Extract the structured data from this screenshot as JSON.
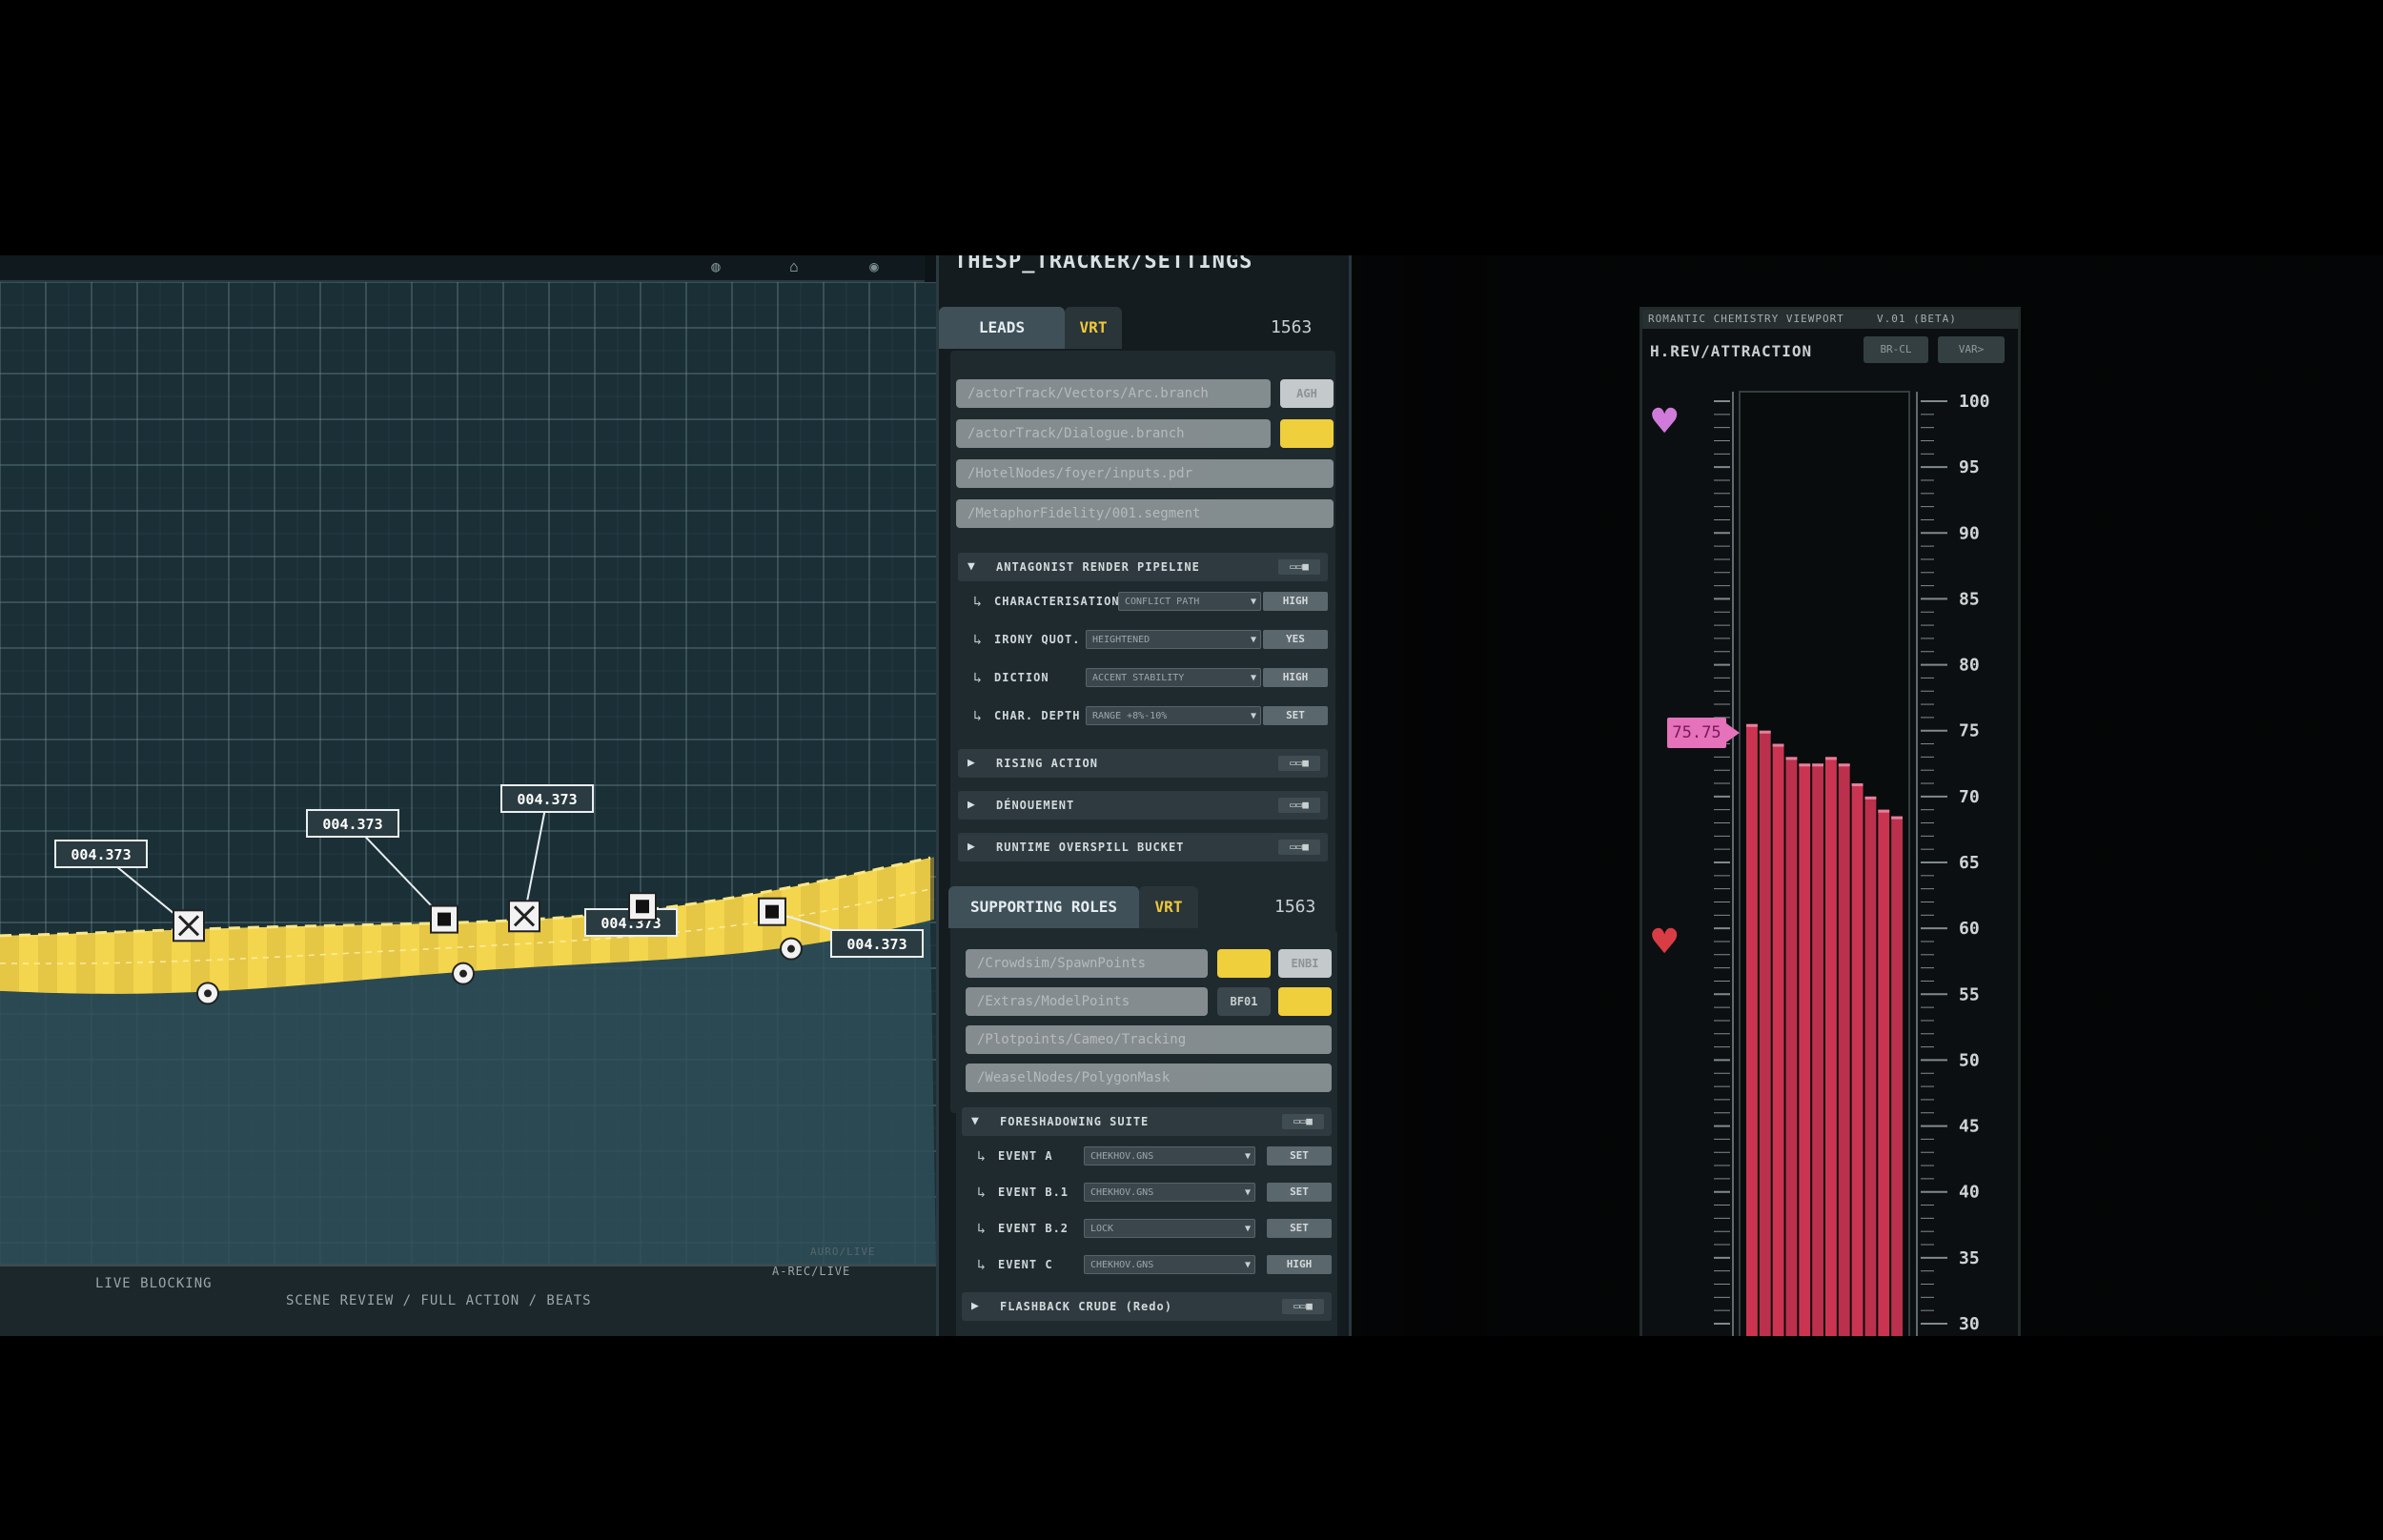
{
  "graph": {
    "top_icons": [
      "globe-icon",
      "person-icon",
      "camera-icon"
    ],
    "point_labels": [
      "004.373",
      "004.373",
      "004.373",
      "004.373",
      "004.373"
    ],
    "bottom_bar": {
      "left_text": "LIVE BLOCKING",
      "mid_text": "SCENE REVIEW / FULL ACTION / BEATS",
      "corner_text": "A-REC/LIVE",
      "graph_caption": "AURO/LIVE"
    },
    "colors": {
      "band": "#f4d64e",
      "band_dark": "#d8b63b",
      "grid": "#6f8a92",
      "fill": "#2f4e58"
    }
  },
  "settings": {
    "title": "THESP_TRACKER/SETTINGS",
    "leads_section": {
      "tab_label": "LEADS",
      "vrt_label": "VRT",
      "count": "1563",
      "paths": [
        {
          "value": "/actorTrack/Vectors/Arc.branch",
          "button": "AGH",
          "button_color": "grey"
        },
        {
          "value": "/actorTrack/Dialogue.branch",
          "button": "",
          "button_color": "yellow"
        },
        {
          "value": "/HotelNodes/foyer/inputs.pdr",
          "button": null
        },
        {
          "value": "/MetaphorFidelity/001.segment",
          "button": null
        }
      ],
      "pipeline_group": "ANTAGONIST RENDER PIPELINE",
      "pipeline_items": [
        {
          "label": "CHARACTERISATION",
          "select": "CONFLICT PATH",
          "value": "HIGH"
        },
        {
          "label": "IRONY QUOT.",
          "select": "HEIGHTENED",
          "value": "YES"
        },
        {
          "label": "DICTION",
          "select": "ACCENT STABILITY",
          "value": "HIGH"
        },
        {
          "label": "CHAR. DEPTH",
          "select": "RANGE +8%-10%",
          "value": "SET"
        }
      ],
      "collapsed_groups": [
        "RISING ACTION",
        "DÉNOUEMENT",
        "RUNTIME OVERSPILL BUCKET"
      ]
    },
    "supporting_section": {
      "tab_label": "SUPPORTING ROLES",
      "vrt_label": "VRT",
      "count": "1563",
      "paths": [
        {
          "value": "/Crowdsim/SpawnPoints",
          "buttons": [
            {
              "text": "",
              "color": "yellow"
            },
            {
              "text": "ENBI",
              "color": "grey"
            }
          ]
        },
        {
          "value": "/Extras/ModelPoints",
          "buttons": [
            {
              "text": "BF01",
              "color": "dark"
            },
            {
              "text": "",
              "color": "yellow"
            }
          ]
        },
        {
          "value": "/Plotpoints/Cameo/Tracking",
          "buttons": []
        },
        {
          "value": "/WeaselNodes/PolygonMask",
          "buttons": []
        }
      ],
      "suite_group": "FORESHADOWING SUITE",
      "suite_items": [
        {
          "label": "EVENT A",
          "select": "CHEKHOV.GNS",
          "value": "SET"
        },
        {
          "label": "EVENT B.1",
          "select": "CHEKHOV.GNS",
          "value": "SET"
        },
        {
          "label": "EVENT B.2",
          "select": "LOCK",
          "value": "SET"
        },
        {
          "label": "EVENT C",
          "select": "CHEKHOV.GNS",
          "value": "HIGH"
        }
      ],
      "last_group": "FLASHBACK CRUDE (Redo)"
    }
  },
  "chemistry": {
    "header_left": "ROMANTIC CHEMISTRY VIEWPORT",
    "header_right": "V.01 (BETA)",
    "title": "H.REV/ATTRACTION",
    "btn1": "BR-CL",
    "btn2": "VAR>",
    "marker_value": "75.75",
    "heart_top_color": "#e789f2",
    "heart_bottom_color": "#f0434d",
    "chart_data": {
      "type": "bar",
      "ylim": [
        30,
        100
      ],
      "yticks": [
        100,
        95,
        90,
        85,
        80,
        75,
        70,
        65,
        60,
        55,
        50,
        45,
        40,
        35,
        30
      ],
      "values": [
        75.5,
        75,
        74,
        73,
        72.5,
        72.5,
        73,
        72.5,
        71,
        70,
        69,
        68.5
      ],
      "bar_color": "#e23a5a"
    }
  }
}
